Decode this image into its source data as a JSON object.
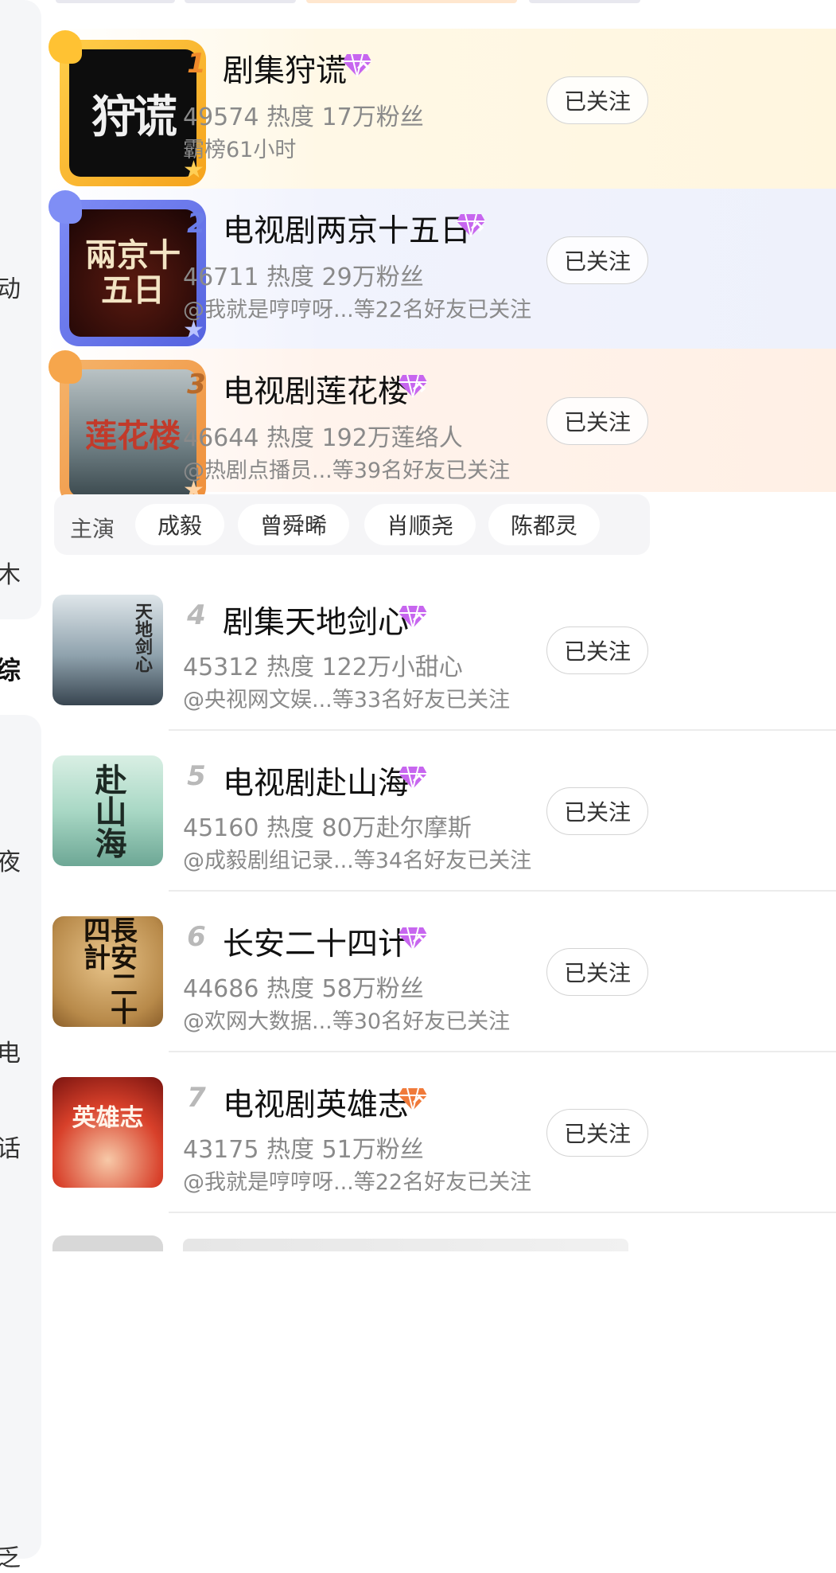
{
  "rail": {
    "chars": [
      "动",
      "木",
      "综",
      "夜",
      "电",
      "话",
      "乏"
    ],
    "active": "综"
  },
  "list": [
    {
      "rank": "1",
      "title": "剧集狩谎",
      "heat": "49574",
      "heat_label": "热度",
      "fans": "17万粉丝",
      "sub": "霸榜61小时",
      "follow": "已关注",
      "poster_text": "狩谎",
      "gem_color": "#b84ee3"
    },
    {
      "rank": "2",
      "title": "电视剧两京十五日",
      "heat": "46711",
      "heat_label": "热度",
      "fans": "29万粉丝",
      "sub": "@我就是哼哼呀...等22名好友已关注",
      "follow": "已关注",
      "poster_text": "兩京十五日",
      "gem_color": "#b84ee3"
    },
    {
      "rank": "3",
      "title": "电视剧莲花楼",
      "heat": "46644",
      "heat_label": "热度",
      "fans": "192万莲络人",
      "sub": "@热剧点播员...等39名好友已关注",
      "follow": "已关注",
      "poster_text": "莲花楼",
      "gem_color": "#b84ee3"
    },
    {
      "rank": "4",
      "title": "剧集天地剑心",
      "heat": "45312",
      "heat_label": "热度",
      "fans": "122万小甜心",
      "sub": "@央视网文娱...等33名好友已关注",
      "follow": "已关注",
      "poster_text": "天地剑心",
      "gem_color": "#b84ee3"
    },
    {
      "rank": "5",
      "title": "电视剧赴山海",
      "heat": "45160",
      "heat_label": "热度",
      "fans": "80万赴尔摩斯",
      "sub": "@成毅剧组记录...等34名好友已关注",
      "follow": "已关注",
      "poster_text": "赴山海",
      "gem_color": "#b84ee3"
    },
    {
      "rank": "6",
      "title": "长安二十四计",
      "heat": "44686",
      "heat_label": "热度",
      "fans": "58万粉丝",
      "sub": "@欢网大数据...等30名好友已关注",
      "follow": "已关注",
      "poster_text": "長安二十四計",
      "gem_color": "#b84ee3"
    },
    {
      "rank": "7",
      "title": "电视剧英雄志",
      "heat": "43175",
      "heat_label": "热度",
      "fans": "51万粉丝",
      "sub": "@我就是哼哼呀...等22名好友已关注",
      "follow": "已关注",
      "poster_text": "英雄志",
      "gem_color": "#f07a3a"
    }
  ],
  "cast": {
    "label": "主演",
    "names": [
      "成毅",
      "曾舜晞",
      "肖顺尧",
      "陈都灵"
    ]
  }
}
